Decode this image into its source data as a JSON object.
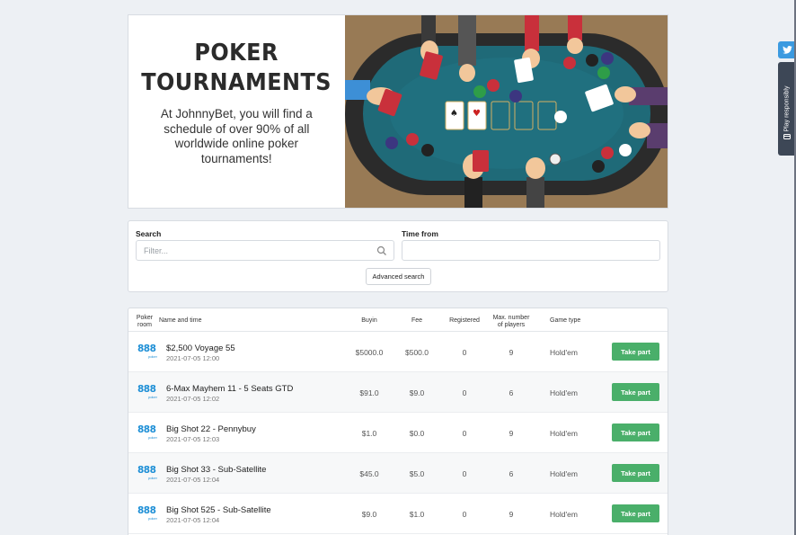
{
  "hero": {
    "title_line1": "POKER",
    "title_line2": "TOURNAMENTS",
    "description": "At JohnnyBet, you will find a schedule of over 90% of all worldwide online poker tournaments!"
  },
  "search": {
    "search_label": "Search",
    "search_placeholder": "Filter...",
    "time_label": "Time from",
    "time_value": "",
    "advanced_label": "Advanced search"
  },
  "table": {
    "headers": {
      "room_line1": "Poker",
      "room_line2": "room",
      "name": "Name and time",
      "buyin": "Buyin",
      "fee": "Fee",
      "registered": "Registered",
      "max_line1": "Max. number",
      "max_line2": "of players",
      "game_type": "Game type"
    },
    "action_label": "Take part",
    "room_logo": {
      "text": "888",
      "sub": "poker"
    },
    "rows": [
      {
        "name": "$2,500 Voyage 55",
        "date": "2021-07-05 12:00",
        "buyin": "$5000.0",
        "fee": "$500.0",
        "registered": "0",
        "max": "9",
        "game": "Hold'em"
      },
      {
        "name": "6-Max Mayhem 11 - 5 Seats GTD",
        "date": "2021-07-05 12:02",
        "buyin": "$91.0",
        "fee": "$9.0",
        "registered": "0",
        "max": "6",
        "game": "Hold'em"
      },
      {
        "name": "Big Shot 22 - Pennybuy",
        "date": "2021-07-05 12:03",
        "buyin": "$1.0",
        "fee": "$0.0",
        "registered": "0",
        "max": "9",
        "game": "Hold'em"
      },
      {
        "name": "Big Shot 33 - Sub-Satellite",
        "date": "2021-07-05 12:04",
        "buyin": "$45.0",
        "fee": "$5.0",
        "registered": "0",
        "max": "6",
        "game": "Hold'em"
      },
      {
        "name": "Big Shot 525 - Sub-Satellite",
        "date": "2021-07-05 12:04",
        "buyin": "$9.0",
        "fee": "$1.0",
        "registered": "0",
        "max": "9",
        "game": "Hold'em"
      }
    ]
  },
  "sidebar": {
    "play_responsibly": "Play responsibly",
    "twitter_icon": "twitter-icon"
  },
  "colors": {
    "accent_green": "#4aaf6a",
    "brand_888": "#1e8fd6",
    "twitter_blue": "#3b9ae0",
    "felt": "#1f6a78"
  }
}
